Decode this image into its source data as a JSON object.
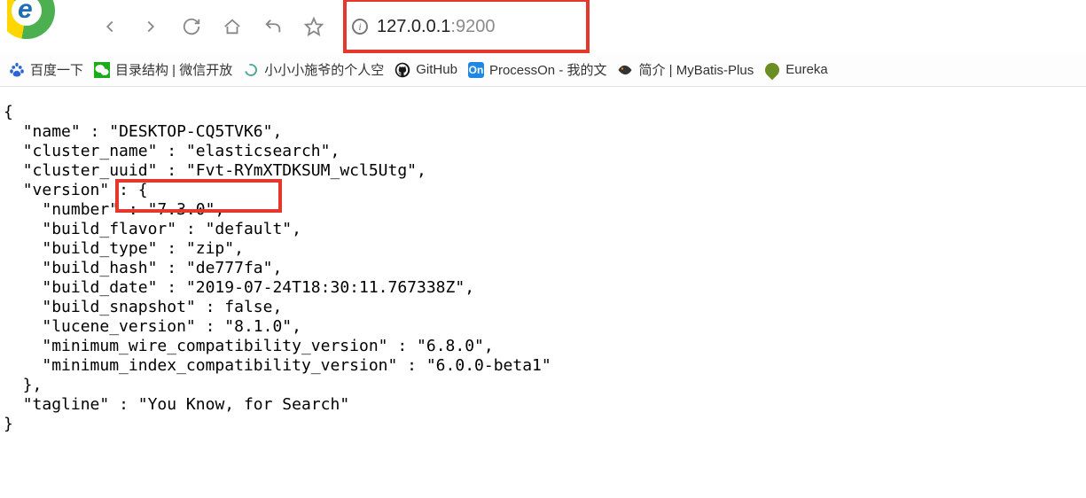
{
  "url": {
    "host": "127.0.0.1",
    "port": ":9200"
  },
  "bookmarks": {
    "b1": "百度一下",
    "b2": "目录结构 | 微信开放",
    "b3": "小小小施爷的个人空",
    "b4": "GitHub",
    "b5": "ProcessOn - 我的文",
    "b6": "简介 | MyBatis-Plus",
    "b7": "Eureka"
  },
  "json": {
    "name_k": "\"name\"",
    "name_v": "\"DESKTOP-CQ5TVK6\"",
    "cluster_name_k": "\"cluster_name\"",
    "cluster_name_v": "\"elasticsearch\"",
    "cluster_uuid_k": "\"cluster_uuid\"",
    "cluster_uuid_v": "\"Fvt-RYmXTDKSUM_wcl5Utg\"",
    "version_k": "\"version\"",
    "number_k": "\"number\"",
    "number_v": "\"7.3.0\"",
    "build_flavor_k": "\"build_flavor\"",
    "build_flavor_v": "\"default\"",
    "build_type_k": "\"build_type\"",
    "build_type_v": "\"zip\"",
    "build_hash_k": "\"build_hash\"",
    "build_hash_v": "\"de777fa\"",
    "build_date_k": "\"build_date\"",
    "build_date_v": "\"2019-07-24T18:30:11.767338Z\"",
    "build_snapshot_k": "\"build_snapshot\"",
    "build_snapshot_v": "false",
    "lucene_version_k": "\"lucene_version\"",
    "lucene_version_v": "\"8.1.0\"",
    "min_wire_k": "\"minimum_wire_compatibility_version\"",
    "min_wire_v": "\"6.8.0\"",
    "min_index_k": "\"minimum_index_compatibility_version\"",
    "min_index_v": "\"6.0.0-beta1\"",
    "tagline_k": "\"tagline\"",
    "tagline_v": "\"You Know, for Search\""
  }
}
